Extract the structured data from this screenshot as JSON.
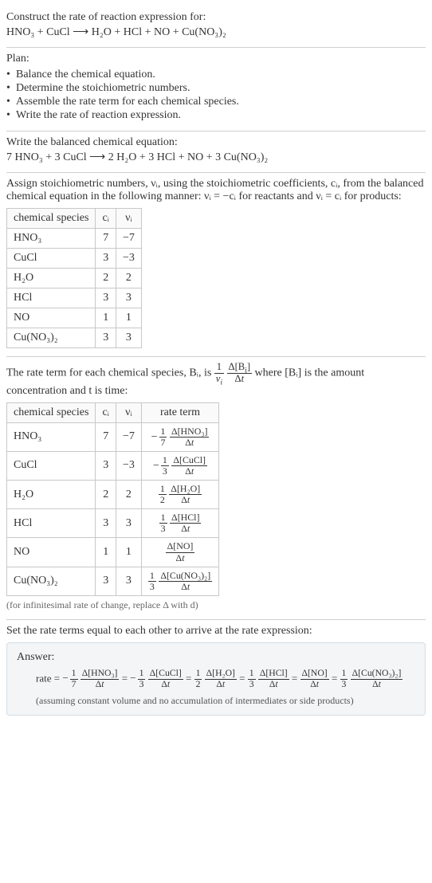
{
  "intro": {
    "construct": "Construct the rate of reaction expression for:",
    "unbalanced_eq": "HNO₃ + CuCl ⟶ H₂O + HCl + NO + Cu(NO₃)₂"
  },
  "plan": {
    "heading": "Plan:",
    "items": [
      "Balance the chemical equation.",
      "Determine the stoichiometric numbers.",
      "Assemble the rate term for each chemical species.",
      "Write the rate of reaction expression."
    ]
  },
  "balanced": {
    "heading": "Write the balanced chemical equation:",
    "equation": "7 HNO₃ + 3 CuCl ⟶ 2 H₂O + 3 HCl + NO + 3 Cu(NO₃)₂"
  },
  "stoich": {
    "heading": "Assign stoichiometric numbers, νᵢ, using the stoichiometric coefficients, cᵢ, from the balanced chemical equation in the following manner: νᵢ = −cᵢ for reactants and νᵢ = cᵢ for products:",
    "headers": {
      "species": "chemical species",
      "ci": "cᵢ",
      "vi": "νᵢ"
    },
    "rows": [
      {
        "species": "HNO₃",
        "ci": "7",
        "vi": "−7"
      },
      {
        "species": "CuCl",
        "ci": "3",
        "vi": "−3"
      },
      {
        "species": "H₂O",
        "ci": "2",
        "vi": "2"
      },
      {
        "species": "HCl",
        "ci": "3",
        "vi": "3"
      },
      {
        "species": "NO",
        "ci": "1",
        "vi": "1"
      },
      {
        "species": "Cu(NO₃)₂",
        "ci": "3",
        "vi": "3"
      }
    ]
  },
  "rateterm": {
    "heading_pre": "The rate term for each chemical species, Bᵢ, is ",
    "heading_post": " where [Bᵢ] is the amount concentration and t is time:",
    "headers": {
      "species": "chemical species",
      "ci": "cᵢ",
      "vi": "νᵢ",
      "rate": "rate term"
    },
    "rows": [
      {
        "species": "HNO₃",
        "ci": "7",
        "vi": "−7",
        "sign": "−",
        "coef_num": "1",
        "coef_den": "7",
        "conc": "Δ[HNO₃]"
      },
      {
        "species": "CuCl",
        "ci": "3",
        "vi": "−3",
        "sign": "−",
        "coef_num": "1",
        "coef_den": "3",
        "conc": "Δ[CuCl]"
      },
      {
        "species": "H₂O",
        "ci": "2",
        "vi": "2",
        "sign": "",
        "coef_num": "1",
        "coef_den": "2",
        "conc": "Δ[H₂O]"
      },
      {
        "species": "HCl",
        "ci": "3",
        "vi": "3",
        "sign": "",
        "coef_num": "1",
        "coef_den": "3",
        "conc": "Δ[HCl]"
      },
      {
        "species": "NO",
        "ci": "1",
        "vi": "1",
        "sign": "",
        "coef_num": "",
        "coef_den": "",
        "conc": "Δ[NO]"
      },
      {
        "species": "Cu(NO₃)₂",
        "ci": "3",
        "vi": "3",
        "sign": "",
        "coef_num": "1",
        "coef_den": "3",
        "conc": "Δ[Cu(NO₃)₂]"
      }
    ],
    "note": "(for infinitesimal rate of change, replace Δ with d)"
  },
  "final": {
    "heading": "Set the rate terms equal to each other to arrive at the rate expression:",
    "answer_label": "Answer:",
    "rate_label": "rate = ",
    "terms": [
      {
        "sign": "−",
        "num": "1",
        "den": "7",
        "conc": "Δ[HNO₃]"
      },
      {
        "sign": "−",
        "num": "1",
        "den": "3",
        "conc": "Δ[CuCl]"
      },
      {
        "sign": "",
        "num": "1",
        "den": "2",
        "conc": "Δ[H₂O]"
      },
      {
        "sign": "",
        "num": "1",
        "den": "3",
        "conc": "Δ[HCl]"
      },
      {
        "sign": "",
        "num": "",
        "den": "",
        "conc": "Δ[NO]"
      },
      {
        "sign": "",
        "num": "1",
        "den": "3",
        "conc": "Δ[Cu(NO₃)₂]"
      }
    ],
    "note": "(assuming constant volume and no accumulation of intermediates or side products)"
  },
  "chart_data": {
    "type": "table",
    "title": "Stoichiometric numbers and rate terms",
    "columns": [
      "chemical species",
      "cᵢ",
      "νᵢ",
      "rate term"
    ],
    "rows": [
      [
        "HNO₃",
        7,
        -7,
        "-(1/7) Δ[HNO₃]/Δt"
      ],
      [
        "CuCl",
        3,
        -3,
        "-(1/3) Δ[CuCl]/Δt"
      ],
      [
        "H₂O",
        2,
        2,
        "(1/2) Δ[H₂O]/Δt"
      ],
      [
        "HCl",
        3,
        3,
        "(1/3) Δ[HCl]/Δt"
      ],
      [
        "NO",
        1,
        1,
        "Δ[NO]/Δt"
      ],
      [
        "Cu(NO₃)₂",
        3,
        3,
        "(1/3) Δ[Cu(NO₃)₂]/Δt"
      ]
    ],
    "rate_expression": "rate = -(1/7) Δ[HNO₃]/Δt = -(1/3) Δ[CuCl]/Δt = (1/2) Δ[H₂O]/Δt = (1/3) Δ[HCl]/Δt = Δ[NO]/Δt = (1/3) Δ[Cu(NO₃)₂]/Δt"
  }
}
